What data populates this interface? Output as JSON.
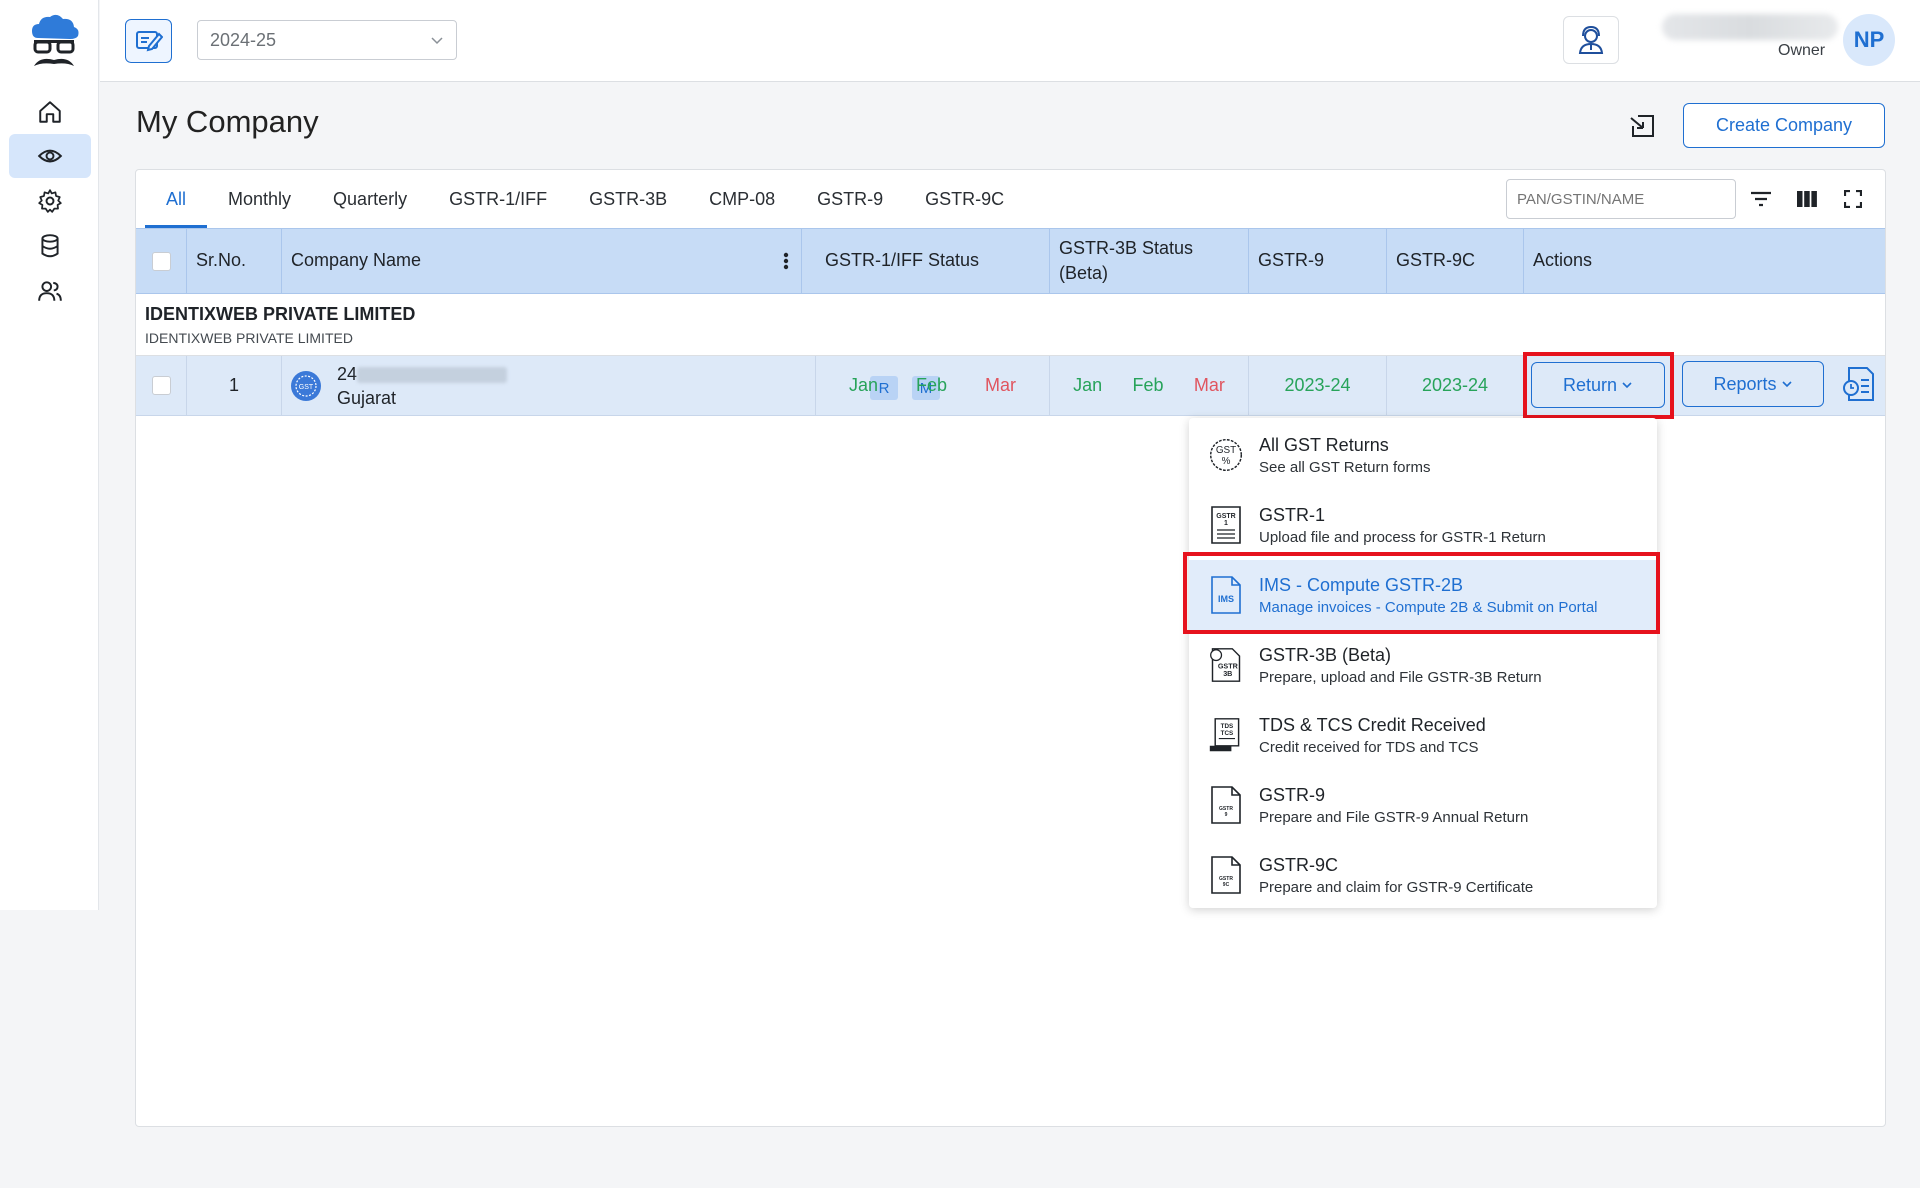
{
  "topbar": {
    "year": "2024-25",
    "user_role": "Owner",
    "avatar_initials": "NP"
  },
  "page": {
    "title": "My Company",
    "create_button": "Create Company"
  },
  "tabs": [
    "All",
    "Monthly",
    "Quarterly",
    "GSTR-1/IFF",
    "GSTR-3B",
    "CMP-08",
    "GSTR-9",
    "GSTR-9C"
  ],
  "search": {
    "placeholder": "PAN/GSTIN/NAME"
  },
  "table": {
    "headers": {
      "srno": "Sr.No.",
      "company": "Company Name",
      "gstr1": "GSTR-1/IFF Status",
      "gstr3b": "GSTR-3B Status",
      "gstr3b_sub": "(Beta)",
      "gstr9": "GSTR-9",
      "gstr9c": "GSTR-9C",
      "actions": "Actions"
    },
    "group": {
      "title": "IDENTIXWEB PRIVATE LIMITED",
      "subtitle": "IDENTIXWEB PRIVATE LIMITED"
    },
    "row": {
      "srno": "1",
      "gstin_prefix": "24",
      "state": "Gujarat",
      "badge_r": "R",
      "badge_m": "M",
      "gstr1_months": [
        "Jan",
        "Feb",
        "Mar"
      ],
      "gstr3b_months": [
        "Jan",
        "Feb",
        "Mar"
      ],
      "gstr9": "2023-24",
      "gstr9c": "2023-24",
      "return_button": "Return",
      "reports_button": "Reports"
    }
  },
  "dropdown": {
    "items": [
      {
        "title": "All GST Returns",
        "desc": "See all GST Return forms",
        "icon": "gst-percent-icon"
      },
      {
        "title": "GSTR-1",
        "desc": "Upload file and process for GSTR-1 Return",
        "icon": "gstr1-doc-icon"
      },
      {
        "title": "IMS - Compute GSTR-2B",
        "desc": "Manage invoices - Compute 2B & Submit on Portal",
        "icon": "ims-doc-icon"
      },
      {
        "title": "GSTR-3B (Beta)",
        "desc": "Prepare, upload and File GSTR-3B Return",
        "icon": "gstr3b-doc-icon"
      },
      {
        "title": "TDS & TCS Credit Received",
        "desc": "Credit received for TDS and TCS",
        "icon": "tds-tcs-doc-icon"
      },
      {
        "title": "GSTR-9",
        "desc": "Prepare and File GSTR-9 Annual Return",
        "icon": "gstr9-doc-icon"
      },
      {
        "title": "GSTR-9C",
        "desc": "Prepare and claim for GSTR-9 Certificate",
        "icon": "gstr9c-doc-icon"
      }
    ]
  },
  "colors": {
    "accent": "#1f6fd1",
    "status_ok": "#27a35a",
    "status_pending": "#e0555f",
    "highlight_red": "#e6121d"
  }
}
